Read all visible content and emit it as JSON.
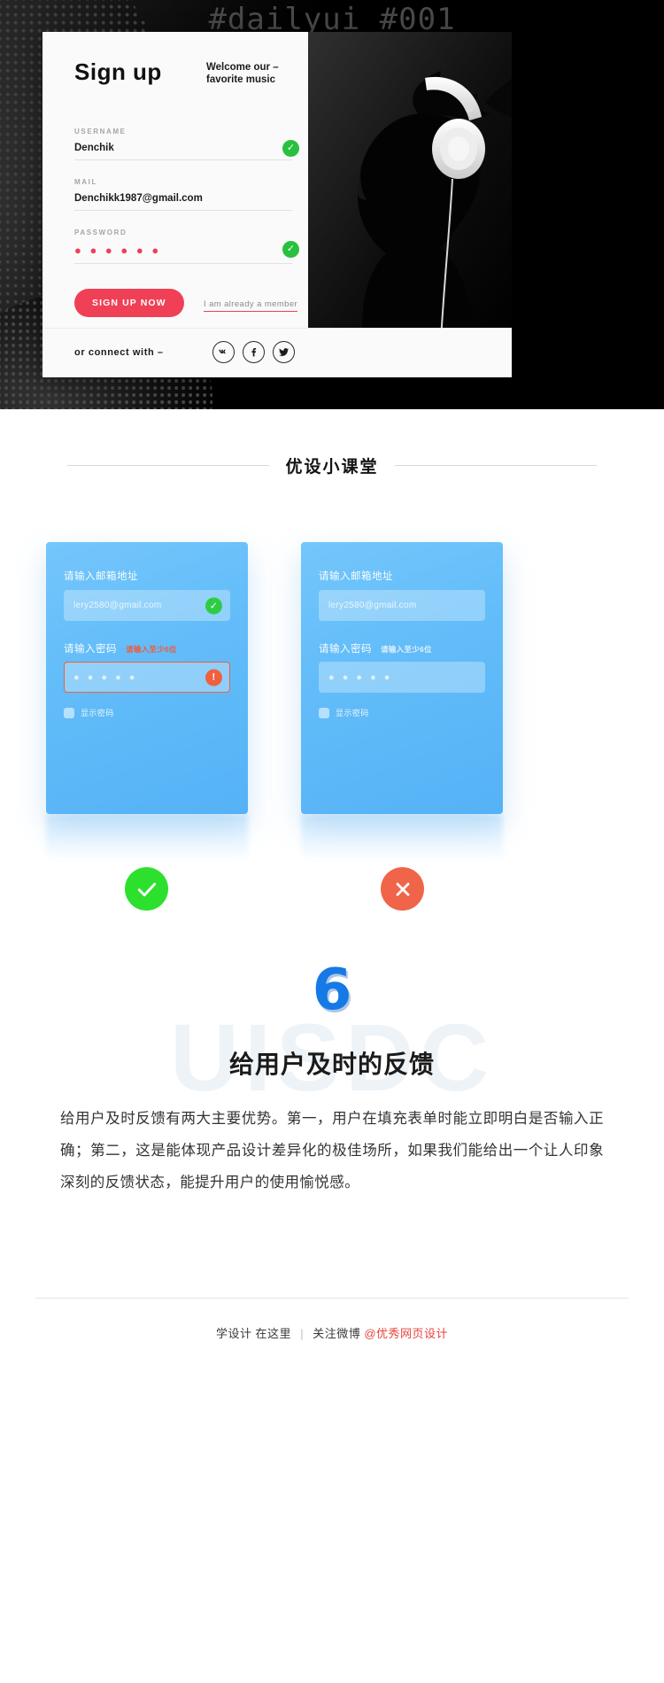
{
  "hero": {
    "watermark": "#dailyui #001",
    "card": {
      "title": "Sign up",
      "welcome": "Welcome our –\nfavorite music",
      "fields": [
        {
          "label": "USERNAME",
          "value": "Denchik",
          "status": "valid"
        },
        {
          "label": "MAIL",
          "value": "Denchikk1987@gmail.com",
          "status": "none"
        },
        {
          "label": "PASSWORD",
          "value": "● ● ● ● ● ●",
          "status": "valid"
        }
      ],
      "cta_label": "SIGN UP NOW",
      "alt_link": "I am already a member",
      "connect_label": "or connect with –",
      "socials": [
        {
          "name": "vk-icon",
          "label": "VK"
        },
        {
          "name": "facebook-icon",
          "label": "Facebook"
        },
        {
          "name": "twitter-icon",
          "label": "Twitter"
        }
      ],
      "accent_color": "#ef4056",
      "valid_color": "#27c13f"
    }
  },
  "section": {
    "title": "优设小课堂"
  },
  "cards": {
    "left": {
      "email_label": "请输入邮箱地址",
      "email_value": "lery2580@gmail.com",
      "email_badge": "✓",
      "password_label": "请输入密码",
      "password_hint": "请输入至少6位",
      "password_hint_color": "#f05a3c",
      "password_value": "● ● ● ● ●",
      "password_badge": "!",
      "show_password_label": "显示密码",
      "state": "error"
    },
    "right": {
      "email_label": "请输入邮箱地址",
      "email_value": "lery2580@gmail.com",
      "email_badge": "",
      "password_label": "请输入密码",
      "password_hint": "请输入至少6位",
      "password_hint_color": "#dff0fd",
      "password_value": "● ● ● ● ●",
      "password_badge": "",
      "show_password_label": "显示密码",
      "state": "plain"
    }
  },
  "verdicts": {
    "good": {
      "icon": "check-icon",
      "color": "#2ee02e"
    },
    "bad": {
      "icon": "cross-icon",
      "color": "#f06449"
    }
  },
  "article": {
    "number": "6",
    "watermark": "UISDC",
    "heading": "给用户及时的反馈",
    "body": "给用户及时反馈有两大主要优势。第一，用户在填充表单时能立即明白是否输入正确；第二，这是能体现产品设计差异化的极佳场所，如果我们能给出一个让人印象深刻的反馈状态，能提升用户的使用愉悦感。"
  },
  "footer": {
    "left": "学设计 在这里",
    "middle": "关注微博",
    "account": "@优秀网页设计",
    "accent_color": "#e8413c"
  }
}
